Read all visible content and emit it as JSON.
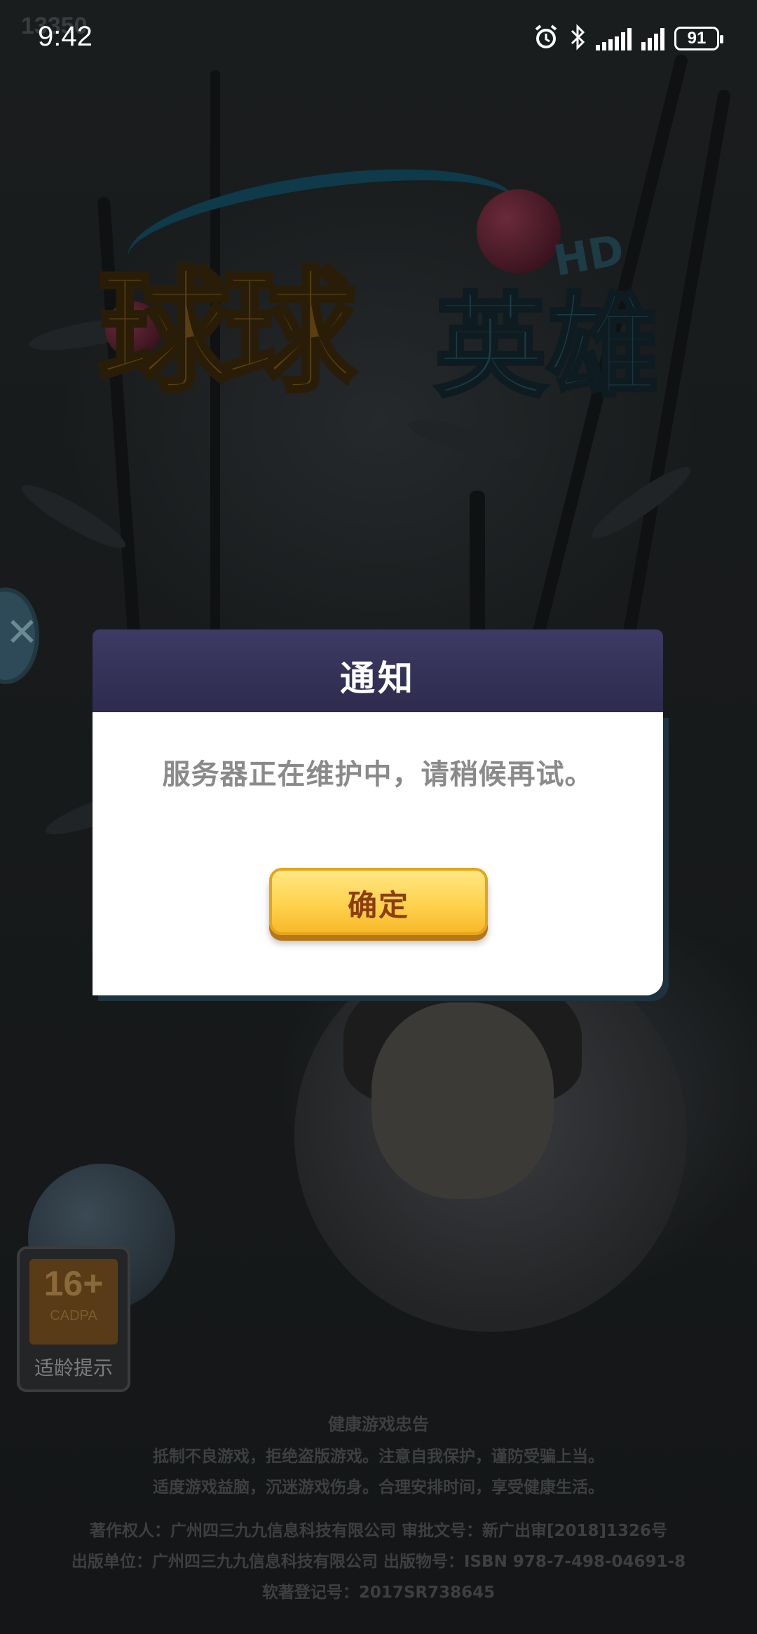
{
  "status_bar": {
    "time": "9:42",
    "version_overlay": "13350",
    "battery_level": "91",
    "icons": [
      "alarm-icon",
      "bluetooth-icon",
      "signal-icon",
      "signal-icon",
      "battery-icon"
    ]
  },
  "game": {
    "logo_main": "球球",
    "logo_sub": "英雄",
    "logo_hd": "HD"
  },
  "age_rating": {
    "rating": "16+",
    "org": "CADPA",
    "label": "适龄提示"
  },
  "footer": {
    "notice_title": "健康游戏忠告",
    "notice_line1": "抵制不良游戏，拒绝盗版游戏。注意自我保护，谨防受骗上当。",
    "notice_line2": "适度游戏益脑，沉迷游戏伤身。合理安排时间，享受健康生活。",
    "copyright_line": "著作权人：广州四三九九信息科技有限公司    审批文号：新广出审[2018]1326号",
    "publisher_line": "出版单位：广州四三九九信息科技有限公司    出版物号：ISBN 978-7-498-04691-8",
    "software_reg": "软著登记号：2017SR738645"
  },
  "dialog": {
    "title": "通知",
    "message": "服务器正在维护中，请稍候再试。",
    "confirm_label": "确定"
  },
  "colors": {
    "dialog_header": "#3d3a64",
    "button_yellow": "#ffd24e",
    "button_text": "#8c3d10",
    "message_text": "#8a8a8a"
  }
}
